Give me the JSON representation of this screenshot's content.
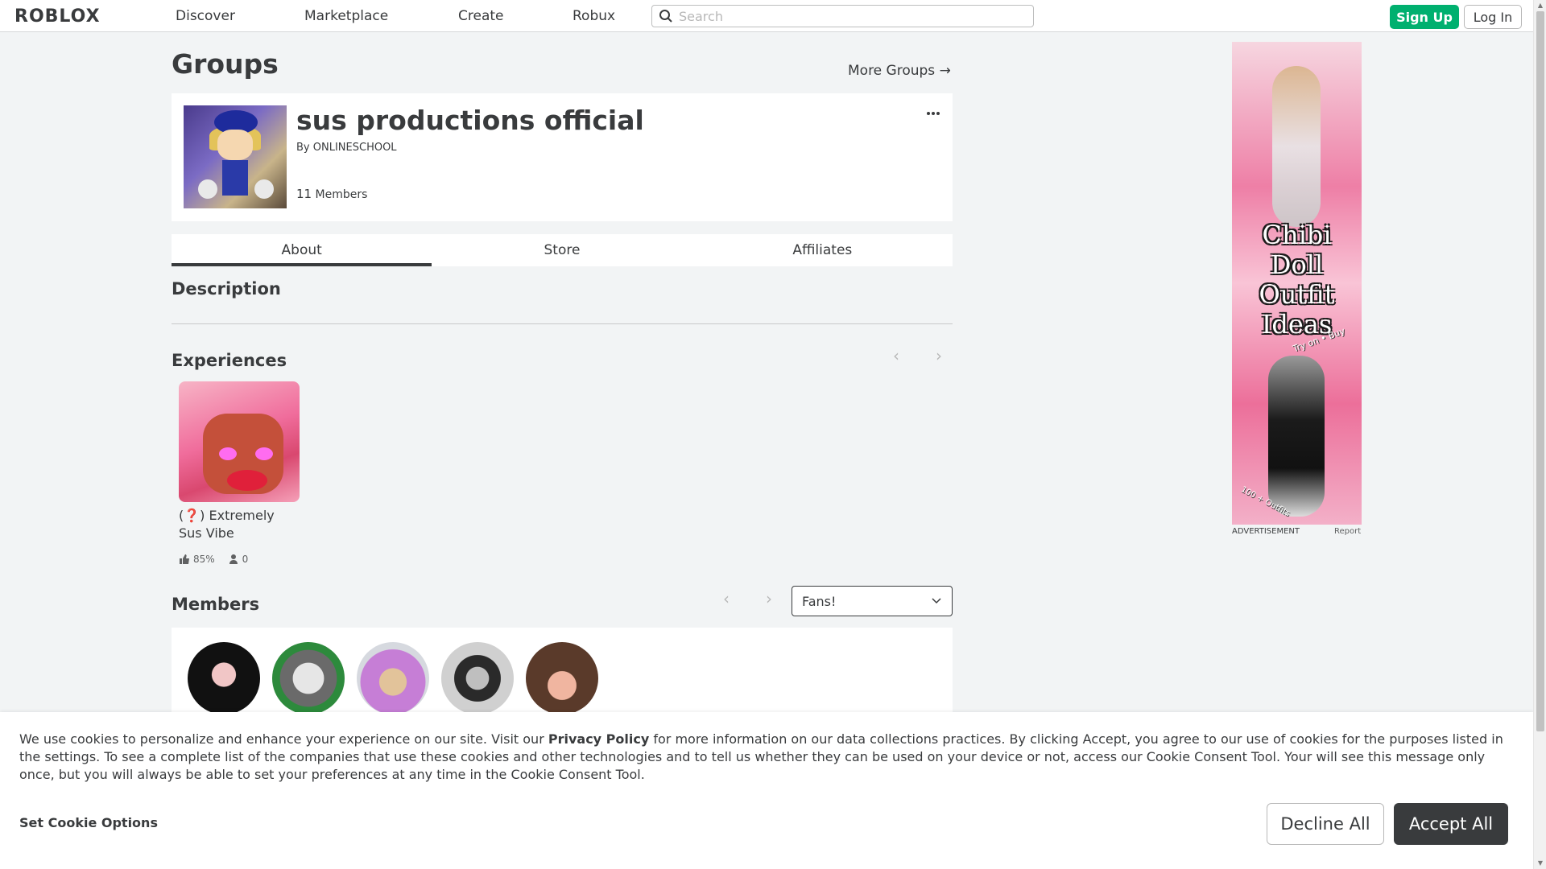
{
  "header": {
    "logo": "ROBLOX",
    "nav": [
      "Discover",
      "Marketplace",
      "Create",
      "Robux"
    ],
    "search_placeholder": "Search",
    "signup_label": "Sign Up",
    "login_label": "Log In"
  },
  "page": {
    "title": "Groups",
    "more_groups": "More Groups →"
  },
  "group": {
    "name": "sus productions official",
    "by_prefix": "By",
    "owner": "ONLINESCHOOL",
    "member_count": "11",
    "members_label": "Members"
  },
  "tabs": [
    {
      "label": "About",
      "active": true
    },
    {
      "label": "Store",
      "active": false
    },
    {
      "label": "Affiliates",
      "active": false
    }
  ],
  "description_title": "Description",
  "experiences": {
    "title": "Experiences",
    "items": [
      {
        "name": "(❓) Extremely Sus Vibe",
        "rating": "85%",
        "players": "0"
      }
    ]
  },
  "members": {
    "title": "Members",
    "role_selected": "Fans!",
    "avatars": [
      "member-1",
      "member-2",
      "member-3",
      "member-4",
      "member-5"
    ]
  },
  "ad": {
    "headline_lines": [
      "Chibi",
      "Doll",
      "Outfit",
      "Ideas"
    ],
    "tagline": "Try on • Buy",
    "tagline2": "100 + Outfits",
    "label": "ADVERTISEMENT",
    "report": "Report"
  },
  "cookie": {
    "text_before": "We use cookies to personalize and enhance your experience on our site. Visit our ",
    "link": "Privacy Policy",
    "text_after": " for more information on our data collections practices. By clicking Accept, you agree to our use of cookies for the purposes listed in the settings. To see a complete list of the companies that use these cookies and other technologies and to tell us whether they can be used on your device or not, access our Cookie Consent Tool. Your will see this message only once, but you will always be able to set your preferences at any time in the Cookie Consent Tool.",
    "options_label": "Set Cookie Options",
    "decline_label": "Decline All",
    "accept_label": "Accept All"
  },
  "colors": {
    "signup_green": "#00b06f",
    "accept_dark": "#393b3d",
    "page_bg": "#f2f4f5"
  }
}
